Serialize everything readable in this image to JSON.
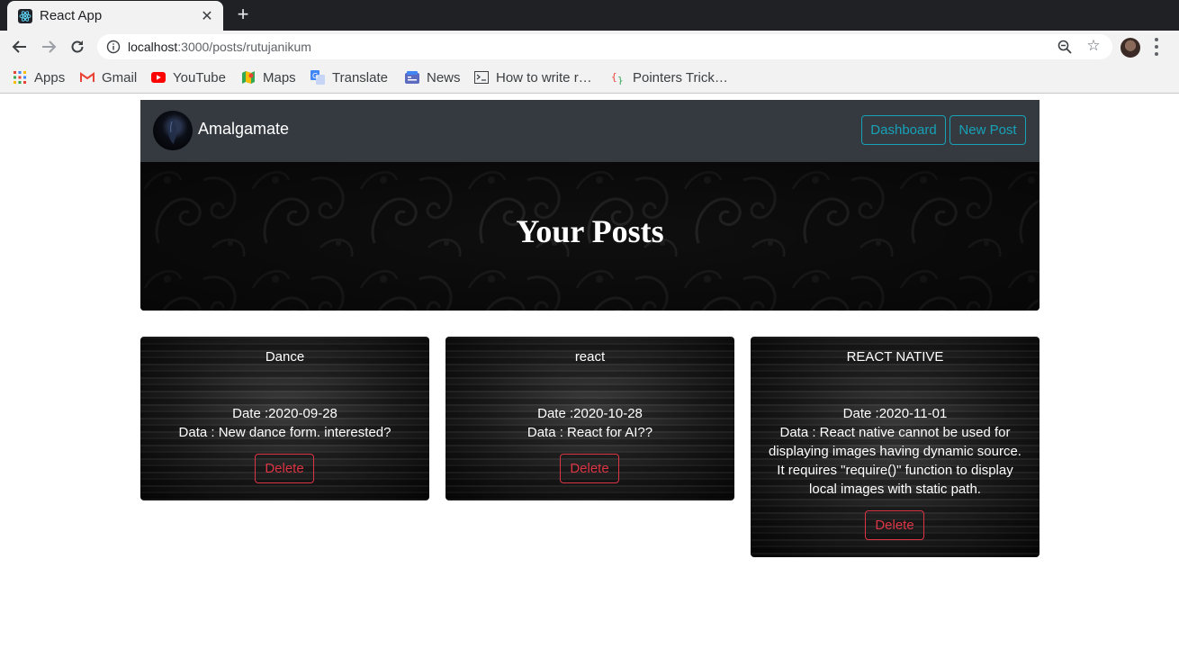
{
  "browser": {
    "tab_title": "React App",
    "url_host": "localhost",
    "url_path": ":3000/posts/rutujanikum",
    "bookmarks": [
      {
        "label": "Apps",
        "icon": "apps-grid-icon"
      },
      {
        "label": "Gmail",
        "icon": "gmail-icon"
      },
      {
        "label": "YouTube",
        "icon": "youtube-icon"
      },
      {
        "label": "Maps",
        "icon": "maps-icon"
      },
      {
        "label": "Translate",
        "icon": "translate-icon"
      },
      {
        "label": "News",
        "icon": "news-icon"
      },
      {
        "label": "How to write r…",
        "icon": "terminal-icon"
      },
      {
        "label": "Pointers Trick…",
        "icon": "braces-icon"
      }
    ]
  },
  "navbar": {
    "brand": "Amalgamate",
    "dashboard_label": "Dashboard",
    "new_post_label": "New Post"
  },
  "hero": {
    "title": "Your Posts"
  },
  "posts": [
    {
      "title": "Dance",
      "date": "Date :2020-09-28",
      "data": "Data : New dance form. interested?",
      "delete_label": "Delete"
    },
    {
      "title": "react",
      "date": "Date :2020-10-28",
      "data": "Data : React for AI??",
      "delete_label": "Delete"
    },
    {
      "title": "REACT NATIVE",
      "date": "Date :2020-11-01",
      "data": "Data : React native cannot be used for displaying images having dynamic source. It requires \"require()\" function to display local images with static path.",
      "delete_label": "Delete"
    }
  ],
  "colors": {
    "info": "#17a2b8",
    "danger": "#dc3545",
    "navbar_bg": "#343a40"
  }
}
